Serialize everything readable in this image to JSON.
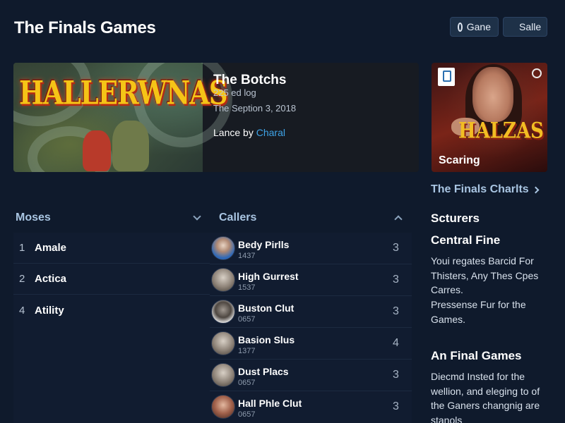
{
  "header": {
    "title": "The Finals Games",
    "buttons": [
      {
        "label": "Gane",
        "icon": "ring-icon"
      },
      {
        "label": "Salle",
        "icon": "diamond-icon"
      }
    ]
  },
  "hero": {
    "art_logo": "HALLERWNAS",
    "title": "The Botchs",
    "line1": "225 ed log",
    "line2": "The Seption 3, 2018",
    "credit_prefix": "Lance by",
    "credit_accent": "Charal",
    "accent_color": "#3ea4e8"
  },
  "side_card": {
    "art_logo": "HALZAS",
    "caption": "Scaring"
  },
  "charts_link": {
    "label": "The Finals Charlts"
  },
  "left_list": {
    "heading": "Moses",
    "items": [
      {
        "num": "1",
        "label": "Amale"
      },
      {
        "num": "2",
        "label": "Actica"
      },
      {
        "num": "4",
        "label": "Atility"
      }
    ]
  },
  "mid_list": {
    "heading": "Callers",
    "items": [
      {
        "name": "Bedy Pirlls",
        "code": "1437",
        "count": "3",
        "avatar": "blue"
      },
      {
        "name": "High Gurrest",
        "code": "1537",
        "count": "3",
        "avatar": "gray"
      },
      {
        "name": "Buston Clut",
        "code": "0657",
        "count": "3",
        "avatar": "light"
      },
      {
        "name": "Basion Slus",
        "code": "1377",
        "count": "4",
        "avatar": "gray"
      },
      {
        "name": "Dust Placs",
        "code": "0657",
        "count": "3",
        "avatar": "gray"
      },
      {
        "name": "Hall Phle Clut",
        "code": "0657",
        "count": "3",
        "avatar": "warm"
      }
    ]
  },
  "right_column": {
    "heading1": "Scturers",
    "heading2": "Central Fine",
    "para1": "Youi regates Barcid For Thisters, Any Thes Cpes Carres.",
    "para2": "Pressense Fur for the Games.",
    "heading3": "An Final Games",
    "para3": "Diecmd Insted for the wellion, and eleging to of the Ganers changnig are stanols"
  }
}
